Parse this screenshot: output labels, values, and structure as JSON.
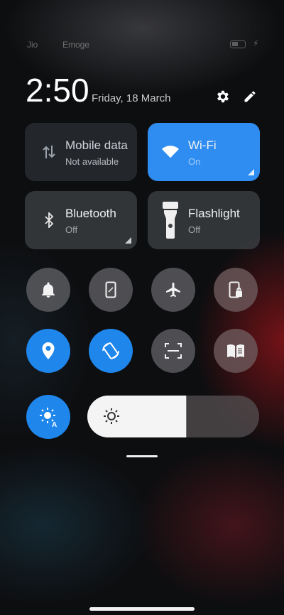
{
  "status_bar": {
    "carrier1": "Jio",
    "carrier2": "Emoge",
    "charge_symbol": "⚡"
  },
  "header": {
    "time": "2:50",
    "date": "Friday, 18 March"
  },
  "tiles": [
    {
      "label": "Mobile data",
      "state": "Not available",
      "icon": "mobile-data-icon",
      "active": false
    },
    {
      "label": "Wi-Fi",
      "state": "On",
      "icon": "wifi-icon",
      "active": true
    },
    {
      "label": "Bluetooth",
      "state": "Off",
      "icon": "bluetooth-icon",
      "active": false
    },
    {
      "label": "Flashlight",
      "state": "Off",
      "icon": "flashlight-icon",
      "active": false
    }
  ],
  "toggles_row1": [
    {
      "icon": "bell-icon",
      "active": false
    },
    {
      "icon": "vibrate-icon",
      "active": false
    },
    {
      "icon": "airplane-icon",
      "active": false
    },
    {
      "icon": "screen-lock-icon",
      "active": false
    }
  ],
  "toggles_row2": [
    {
      "icon": "location-icon",
      "active": true
    },
    {
      "icon": "auto-rotate-icon",
      "active": true
    },
    {
      "icon": "scanner-icon",
      "active": false
    },
    {
      "icon": "reading-mode-icon",
      "active": false
    }
  ],
  "brightness": {
    "auto_icon": "auto-brightness-icon",
    "level": 0.58
  },
  "colors": {
    "accent": "#1f86ec",
    "wifi_tile": "#2f8df2"
  }
}
